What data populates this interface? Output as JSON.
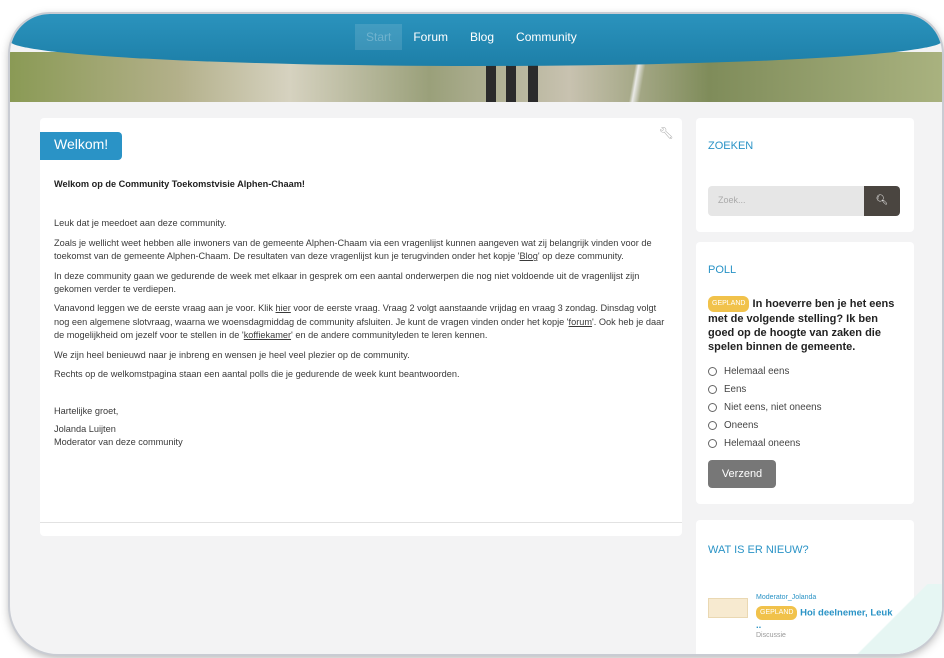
{
  "nav": {
    "items": [
      {
        "label": "Start",
        "active": true
      },
      {
        "label": "Forum",
        "active": false
      },
      {
        "label": "Blog",
        "active": false
      },
      {
        "label": "Community",
        "active": false
      }
    ]
  },
  "welcome": {
    "tab_label": "Welkom!",
    "title": "Welkom op de Community Toekomstvisie Alphen-Chaam!",
    "p1": "Leuk dat je meedoet aan deze community.",
    "p2_a": "Zoals je wellicht weet hebben alle inwoners van de gemeente Alphen-Chaam via een vragenlijst kunnen aangeven wat zij belangrijk vinden voor de toekomst van de gemeente Alphen-Chaam. De resultaten van deze vragenlijst kun je terugvinden onder het kopje '",
    "p2_link": "Blog",
    "p2_b": "' op deze community.",
    "p3": "In deze community gaan we gedurende de week met elkaar in gesprek om een aantal onderwerpen die nog niet voldoende uit de vragenlijst zijn gekomen verder te verdiepen.",
    "p4_a": "Vanavond leggen we de eerste vraag aan je voor. Klik ",
    "p4_link1": "hier",
    "p4_b": " voor de eerste vraag. Vraag 2 volgt aanstaande vrijdag en vraag 3 zondag. Dinsdag volgt nog een algemene slotvraag, waarna we woensdagmiddag de community afsluiten. Je kunt de vragen vinden onder het kopje '",
    "p4_link2": "forum",
    "p4_c": "'. Ook heb je daar de mogelijkheid om jezelf voor te stellen in de '",
    "p4_link3": "koffiekamer",
    "p4_d": "' en de andere communityleden te leren kennen.",
    "p5": "We zijn heel benieuwd naar je inbreng en wensen je heel veel plezier op de community.",
    "p6": "Rechts op de welkomstpagina staan een aantal polls die je gedurende de week kunt beantwoorden.",
    "greeting": "Hartelijke groet,",
    "name": "Jolanda Luijten",
    "role": "Moderator van deze community"
  },
  "search": {
    "title": "ZOEKEN",
    "placeholder": "Zoek..."
  },
  "poll": {
    "title": "POLL",
    "badge": "GEPLAND",
    "question": "In hoeverre ben je het eens met de volgende stelling? Ik ben goed op de hoogte van zaken die spelen binnen de gemeente.",
    "options": [
      "Helemaal eens",
      "Eens",
      "Niet eens, niet oneens",
      "Oneens",
      "Helemaal oneens"
    ],
    "submit_label": "Verzend"
  },
  "news": {
    "title": "WAT IS ER NIEUW?",
    "author": "Moderator_Jolanda",
    "badge": "GEPLAND",
    "item_title": "Hoi deelnemer, Leuk ..",
    "item_type": "Discussie"
  },
  "colors": {
    "accent": "#2a93c6",
    "badge": "#f1c24b",
    "header": "#1f7aa3"
  }
}
